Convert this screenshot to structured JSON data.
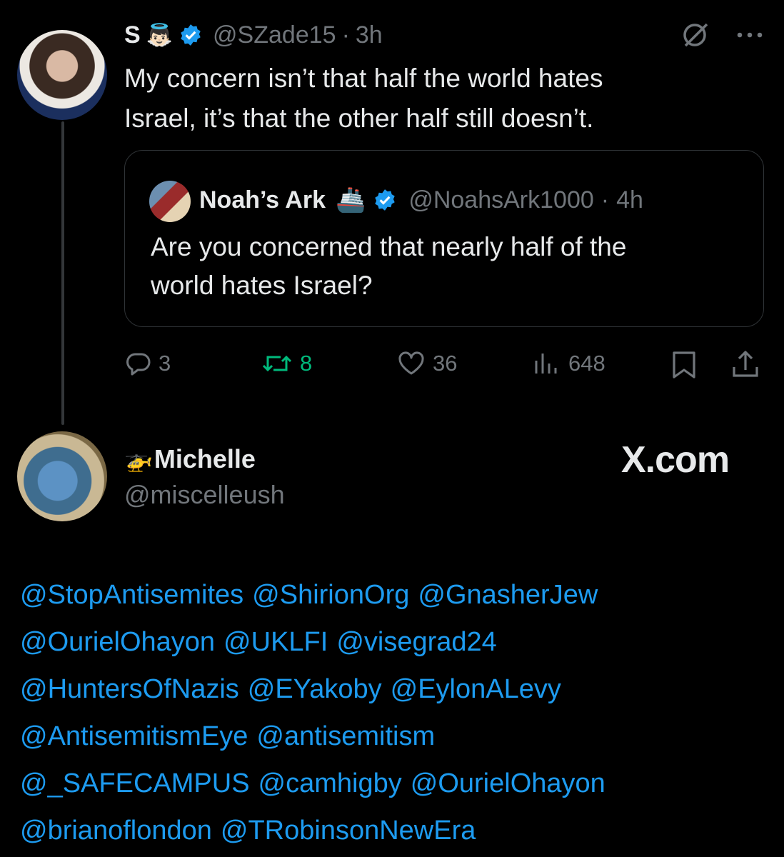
{
  "tweet": {
    "author_name": "S",
    "author_emoji": "👼🏻",
    "author_handle": "@SZade15",
    "time": "3h",
    "text_line1": "My concern isn’t that half the world hates",
    "text_line2": "Israel, it’s that the other half still doesn’t.",
    "icons": [
      "avatar",
      "verified-badge-icon",
      "grok-icon",
      "more-icon"
    ]
  },
  "quote": {
    "author_name": "Noah’s Ark",
    "author_emoji": "🚢",
    "author_handle": "@NoahsArk1000",
    "time": "4h",
    "text_line1": "Are you concerned that nearly half of the",
    "text_line2": "world hates Israel?"
  },
  "actions": {
    "replies": "3",
    "reposts": "8",
    "likes": "36",
    "views": "648",
    "repost_color": "#00ba7c",
    "link_color": "#1d9bf0"
  },
  "reply": {
    "author_emoji": "🚁",
    "author_name": "Michelle",
    "author_handle": "@miscelleush",
    "watermark": "X.com",
    "mention_lines": [
      [
        "@StopAntisemites",
        "@ShirionOrg",
        "@GnasherJew"
      ],
      [
        "@OurielOhayon",
        "@UKLFI",
        "@visegrad24"
      ],
      [
        "@HuntersOfNazis",
        "@EYakoby",
        "@EylonALevy"
      ],
      [
        "@AntisemitismEye",
        "@antisemitism"
      ],
      [
        "@_SAFECAMPUS",
        "@camhigby",
        "@OurielOhayon"
      ],
      [
        "@brianoflondon",
        "@TRobinsonNewEra"
      ]
    ]
  }
}
